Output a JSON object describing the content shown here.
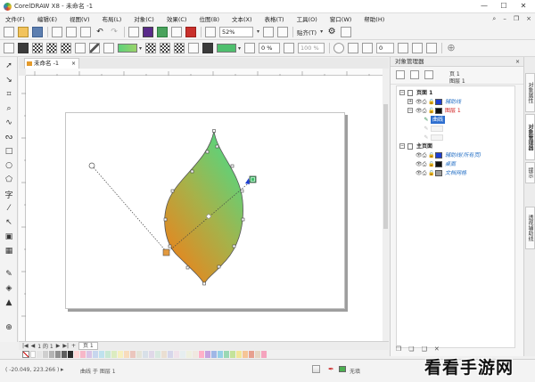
{
  "window": {
    "title": "CorelDRAW X8 - 未命名 -1",
    "min": "—",
    "max": "☐",
    "close": "✕"
  },
  "menu": {
    "items": [
      "文件(F)",
      "编辑(E)",
      "视图(V)",
      "布局(L)",
      "对象(C)",
      "效果(C)",
      "位图(B)",
      "文本(X)",
      "表格(T)",
      "工具(O)",
      "窗口(W)",
      "帮助(H)"
    ],
    "right_icons": [
      "search-icon",
      "minimize-doc-icon",
      "restore-doc-icon",
      "close-doc-icon"
    ]
  },
  "toolbar1": {
    "zoom_value": "52%",
    "snap_label": "贴齐(T)"
  },
  "toolbar2": {
    "fill_value": "0 %",
    "transparency_value": "100 %",
    "angle_value": "0"
  },
  "document": {
    "tab_label": "未命名 -1",
    "tab_close": "×",
    "add_tab": "+"
  },
  "pages": {
    "nav": [
      "|◀",
      "◀",
      "1 的 1",
      "▶",
      "▶|",
      "+"
    ],
    "tab": "页 1"
  },
  "object_manager": {
    "title": "对象管理器",
    "close": "×",
    "current_page": "页 1",
    "current_layer": "图层 1",
    "tree": [
      {
        "level": 0,
        "label": "页面 1",
        "style": "bold"
      },
      {
        "level": 1,
        "label": "辅助线",
        "style": "blue",
        "swatch": "#1e3fd2"
      },
      {
        "level": 1,
        "label": "图层 1",
        "style": "red",
        "swatch": "#111111"
      },
      {
        "level": 2,
        "label": "曲线",
        "style": "selected"
      },
      {
        "level": 2,
        "label": "",
        "style": "dim"
      },
      {
        "level": 2,
        "label": "",
        "style": "dim"
      },
      {
        "level": 0,
        "label": "主页面",
        "style": "bold"
      },
      {
        "level": 1,
        "label": "辅助线(所有页)",
        "style": "blue",
        "swatch": "#1e3fd2"
      },
      {
        "level": 1,
        "label": "桌面",
        "style": "blue",
        "swatch": "#111111"
      },
      {
        "level": 1,
        "label": "文档网格",
        "style": "blue",
        "swatch": "#9a9a9a"
      }
    ]
  },
  "side_tabs": [
    "对象属性",
    "对象管理器",
    "提示",
    "透视辅助线"
  ],
  "status": {
    "coords": "( -20.049, 223.266 )",
    "arrow": "▸",
    "info": "曲线 于 图层 1",
    "fill_none": "无",
    "outline": "无填"
  },
  "watermark": "看看手游网",
  "colors": {
    "leaf_top": "#5ed27a",
    "leaf_bottom": "#e08a23",
    "handle_start": "#e39a3e",
    "handle_end": "#3fbf69",
    "accent": "#2e6fd0"
  }
}
